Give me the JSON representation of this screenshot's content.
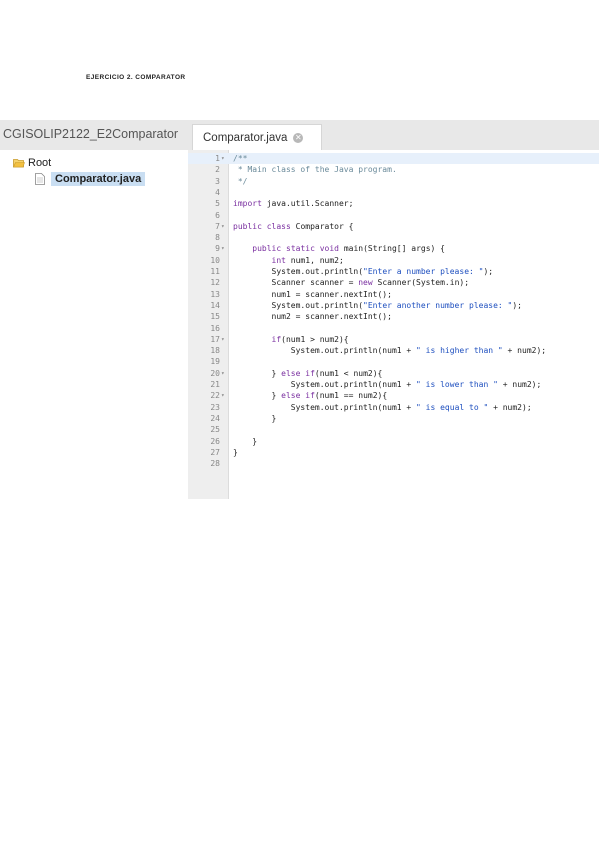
{
  "document": {
    "heading": "EJERCICIO 2. COMPARATOR"
  },
  "project_panel": {
    "title": "CGISOLIP2122_E2Comparator",
    "tree": {
      "root_label": "Root",
      "file_label": "Comparator.java"
    }
  },
  "editor": {
    "tab_label": "Comparator.java",
    "lines": [
      {
        "num": "1",
        "fold": "▾",
        "text": "/**"
      },
      {
        "num": "2",
        "fold": "",
        "text": " * Main class of the Java program."
      },
      {
        "num": "3",
        "fold": "",
        "text": " */"
      },
      {
        "num": "4",
        "fold": "",
        "text": ""
      },
      {
        "num": "5",
        "fold": "",
        "text": "import java.util.Scanner;"
      },
      {
        "num": "6",
        "fold": "",
        "text": ""
      },
      {
        "num": "7",
        "fold": "▾",
        "text": "public class Comparator {"
      },
      {
        "num": "8",
        "fold": "",
        "text": ""
      },
      {
        "num": "9",
        "fold": "▾",
        "text": "    public static void main(String[] args) {"
      },
      {
        "num": "10",
        "fold": "",
        "text": "        int num1, num2;"
      },
      {
        "num": "11",
        "fold": "",
        "text": "        System.out.println(\"Enter a number please: \");"
      },
      {
        "num": "12",
        "fold": "",
        "text": "        Scanner scanner = new Scanner(System.in);"
      },
      {
        "num": "13",
        "fold": "",
        "text": "        num1 = scanner.nextInt();"
      },
      {
        "num": "14",
        "fold": "",
        "text": "        System.out.println(\"Enter another number please: \");"
      },
      {
        "num": "15",
        "fold": "",
        "text": "        num2 = scanner.nextInt();"
      },
      {
        "num": "16",
        "fold": "",
        "text": ""
      },
      {
        "num": "17",
        "fold": "▾",
        "text": "        if(num1 > num2){"
      },
      {
        "num": "18",
        "fold": "",
        "text": "            System.out.println(num1 + \" is higher than \" + num2);"
      },
      {
        "num": "19",
        "fold": "",
        "text": ""
      },
      {
        "num": "20",
        "fold": "▾",
        "text": "        } else if(num1 < num2){"
      },
      {
        "num": "21",
        "fold": "",
        "text": "            System.out.println(num1 + \" is lower than \" + num2);"
      },
      {
        "num": "22",
        "fold": "▾",
        "text": "        } else if(num1 == num2){"
      },
      {
        "num": "23",
        "fold": "",
        "text": "            System.out.println(num1 + \" is equal to \" + num2);"
      },
      {
        "num": "24",
        "fold": "",
        "text": "        }"
      },
      {
        "num": "25",
        "fold": "",
        "text": ""
      },
      {
        "num": "26",
        "fold": "",
        "text": "    }"
      },
      {
        "num": "27",
        "fold": "",
        "text": "}"
      },
      {
        "num": "28",
        "fold": "",
        "text": ""
      }
    ]
  },
  "icons": {
    "folder": "folder-open-icon",
    "file": "file-icon",
    "close": "close-icon"
  },
  "colors": {
    "selection": "#c9def2",
    "active_line": "#e7f0fb",
    "keyword": "#7a2fa0",
    "string": "#1e4fbf",
    "comment": "#6a8a9a",
    "folder": "#e8b640"
  }
}
